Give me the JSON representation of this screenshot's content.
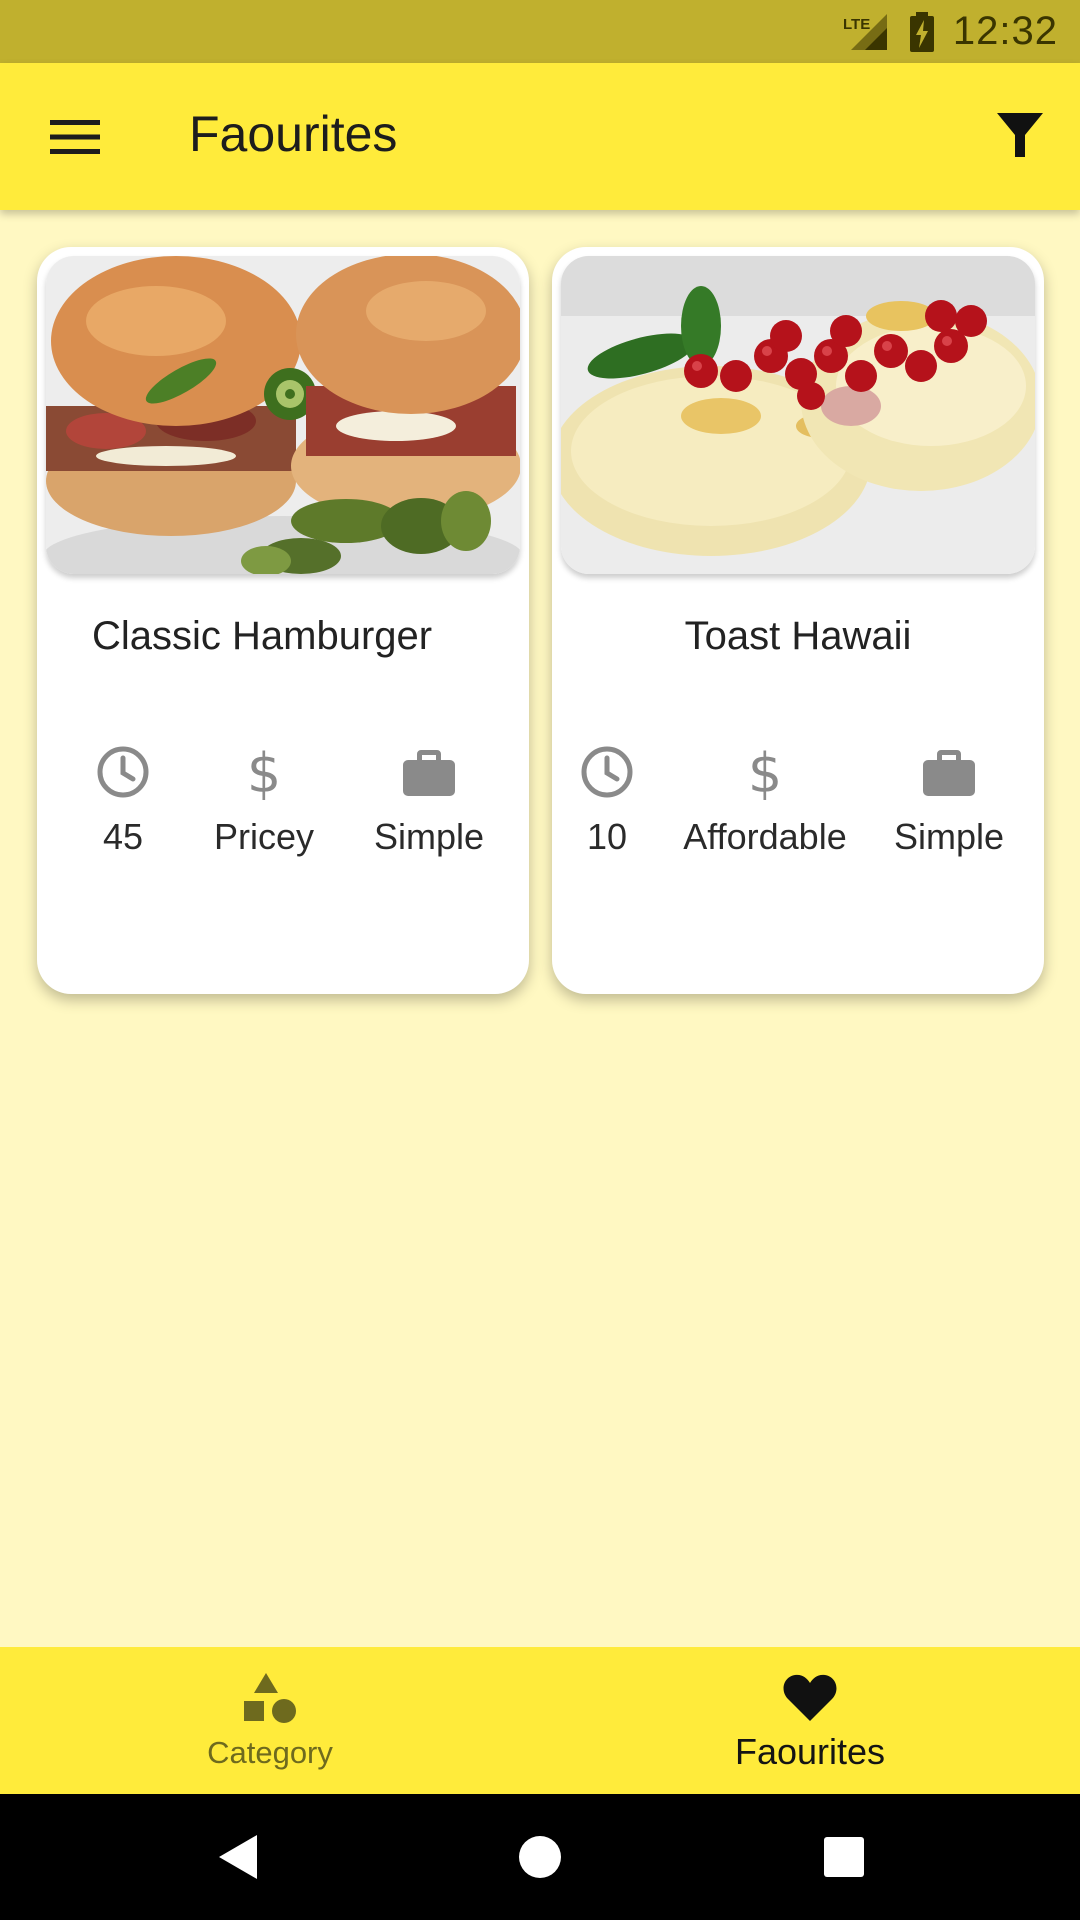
{
  "status_bar": {
    "network": "LTE",
    "time": "12:32"
  },
  "app_bar": {
    "title": "Faourites",
    "menu_icon": "hamburger-menu-icon",
    "filter_icon": "filter-icon"
  },
  "meals": [
    {
      "title": "Classic Hamburger",
      "image": "hamburger-photo",
      "duration": "45",
      "affordability": "Pricey",
      "complexity": "Simple"
    },
    {
      "title": "Toast Hawaii",
      "image": "toast-hawaii-photo",
      "duration": "10",
      "affordability": "Affordable",
      "complexity": "Simple"
    }
  ],
  "meta_icons": {
    "duration": "clock-icon",
    "affordability": "dollar-icon",
    "complexity": "briefcase-icon"
  },
  "bottom_nav": {
    "items": [
      {
        "label": "Category",
        "icon": "category-shapes-icon",
        "selected": false
      },
      {
        "label": "Faourites",
        "icon": "heart-icon",
        "selected": true
      }
    ]
  },
  "colors": {
    "primary": "#FFEB3B",
    "status_bar": "#C0B02E",
    "background": "#FFF8C2",
    "icon_grey": "#8A8A8A"
  }
}
